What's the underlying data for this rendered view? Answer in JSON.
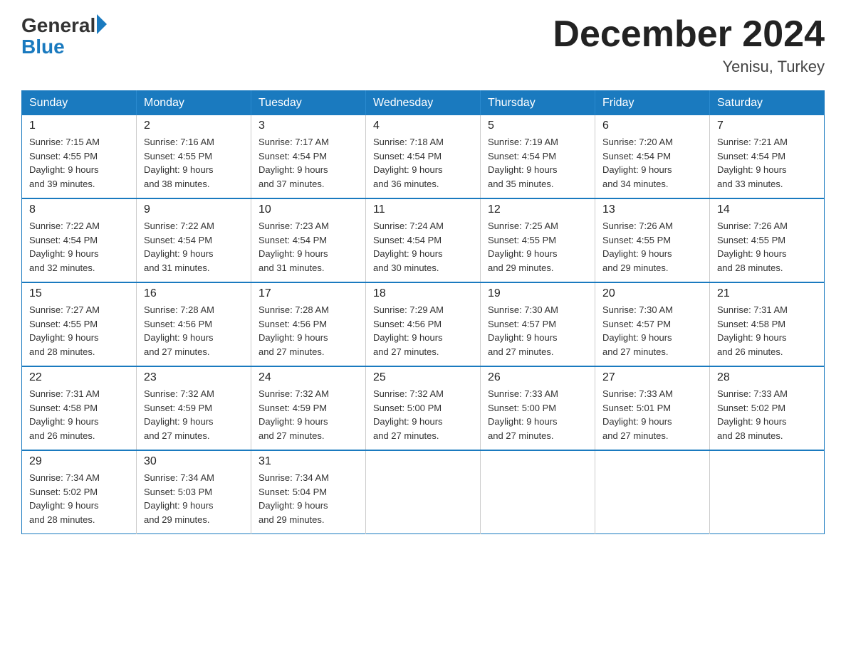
{
  "header": {
    "logo_general": "General",
    "logo_blue": "Blue",
    "month_title": "December 2024",
    "location": "Yenisu, Turkey"
  },
  "days_of_week": [
    "Sunday",
    "Monday",
    "Tuesday",
    "Wednesday",
    "Thursday",
    "Friday",
    "Saturday"
  ],
  "weeks": [
    [
      {
        "day": "1",
        "sunrise": "7:15 AM",
        "sunset": "4:55 PM",
        "daylight": "9 hours and 39 minutes."
      },
      {
        "day": "2",
        "sunrise": "7:16 AM",
        "sunset": "4:55 PM",
        "daylight": "9 hours and 38 minutes."
      },
      {
        "day": "3",
        "sunrise": "7:17 AM",
        "sunset": "4:54 PM",
        "daylight": "9 hours and 37 minutes."
      },
      {
        "day": "4",
        "sunrise": "7:18 AM",
        "sunset": "4:54 PM",
        "daylight": "9 hours and 36 minutes."
      },
      {
        "day": "5",
        "sunrise": "7:19 AM",
        "sunset": "4:54 PM",
        "daylight": "9 hours and 35 minutes."
      },
      {
        "day": "6",
        "sunrise": "7:20 AM",
        "sunset": "4:54 PM",
        "daylight": "9 hours and 34 minutes."
      },
      {
        "day": "7",
        "sunrise": "7:21 AM",
        "sunset": "4:54 PM",
        "daylight": "9 hours and 33 minutes."
      }
    ],
    [
      {
        "day": "8",
        "sunrise": "7:22 AM",
        "sunset": "4:54 PM",
        "daylight": "9 hours and 32 minutes."
      },
      {
        "day": "9",
        "sunrise": "7:22 AM",
        "sunset": "4:54 PM",
        "daylight": "9 hours and 31 minutes."
      },
      {
        "day": "10",
        "sunrise": "7:23 AM",
        "sunset": "4:54 PM",
        "daylight": "9 hours and 31 minutes."
      },
      {
        "day": "11",
        "sunrise": "7:24 AM",
        "sunset": "4:54 PM",
        "daylight": "9 hours and 30 minutes."
      },
      {
        "day": "12",
        "sunrise": "7:25 AM",
        "sunset": "4:55 PM",
        "daylight": "9 hours and 29 minutes."
      },
      {
        "day": "13",
        "sunrise": "7:26 AM",
        "sunset": "4:55 PM",
        "daylight": "9 hours and 29 minutes."
      },
      {
        "day": "14",
        "sunrise": "7:26 AM",
        "sunset": "4:55 PM",
        "daylight": "9 hours and 28 minutes."
      }
    ],
    [
      {
        "day": "15",
        "sunrise": "7:27 AM",
        "sunset": "4:55 PM",
        "daylight": "9 hours and 28 minutes."
      },
      {
        "day": "16",
        "sunrise": "7:28 AM",
        "sunset": "4:56 PM",
        "daylight": "9 hours and 27 minutes."
      },
      {
        "day": "17",
        "sunrise": "7:28 AM",
        "sunset": "4:56 PM",
        "daylight": "9 hours and 27 minutes."
      },
      {
        "day": "18",
        "sunrise": "7:29 AM",
        "sunset": "4:56 PM",
        "daylight": "9 hours and 27 minutes."
      },
      {
        "day": "19",
        "sunrise": "7:30 AM",
        "sunset": "4:57 PM",
        "daylight": "9 hours and 27 minutes."
      },
      {
        "day": "20",
        "sunrise": "7:30 AM",
        "sunset": "4:57 PM",
        "daylight": "9 hours and 27 minutes."
      },
      {
        "day": "21",
        "sunrise": "7:31 AM",
        "sunset": "4:58 PM",
        "daylight": "9 hours and 26 minutes."
      }
    ],
    [
      {
        "day": "22",
        "sunrise": "7:31 AM",
        "sunset": "4:58 PM",
        "daylight": "9 hours and 26 minutes."
      },
      {
        "day": "23",
        "sunrise": "7:32 AM",
        "sunset": "4:59 PM",
        "daylight": "9 hours and 27 minutes."
      },
      {
        "day": "24",
        "sunrise": "7:32 AM",
        "sunset": "4:59 PM",
        "daylight": "9 hours and 27 minutes."
      },
      {
        "day": "25",
        "sunrise": "7:32 AM",
        "sunset": "5:00 PM",
        "daylight": "9 hours and 27 minutes."
      },
      {
        "day": "26",
        "sunrise": "7:33 AM",
        "sunset": "5:00 PM",
        "daylight": "9 hours and 27 minutes."
      },
      {
        "day": "27",
        "sunrise": "7:33 AM",
        "sunset": "5:01 PM",
        "daylight": "9 hours and 27 minutes."
      },
      {
        "day": "28",
        "sunrise": "7:33 AM",
        "sunset": "5:02 PM",
        "daylight": "9 hours and 28 minutes."
      }
    ],
    [
      {
        "day": "29",
        "sunrise": "7:34 AM",
        "sunset": "5:02 PM",
        "daylight": "9 hours and 28 minutes."
      },
      {
        "day": "30",
        "sunrise": "7:34 AM",
        "sunset": "5:03 PM",
        "daylight": "9 hours and 29 minutes."
      },
      {
        "day": "31",
        "sunrise": "7:34 AM",
        "sunset": "5:04 PM",
        "daylight": "9 hours and 29 minutes."
      },
      null,
      null,
      null,
      null
    ]
  ],
  "labels": {
    "sunrise": "Sunrise:",
    "sunset": "Sunset:",
    "daylight": "Daylight:"
  }
}
